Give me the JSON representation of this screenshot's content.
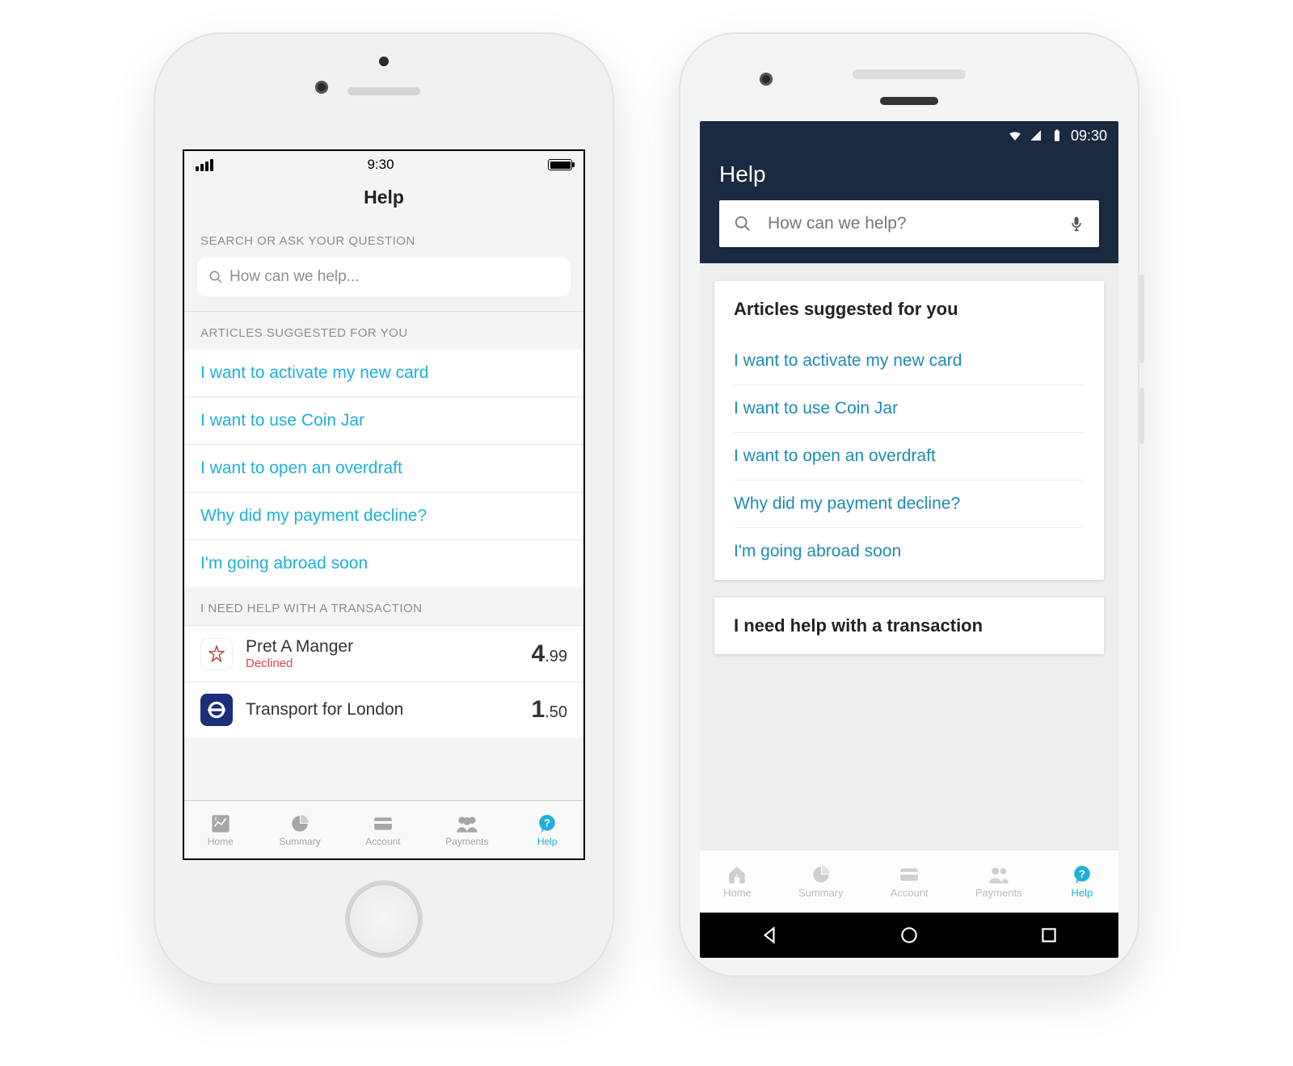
{
  "colors": {
    "accent": "#1eb0d8",
    "appbar": "#1a2a40",
    "declined": "#e3424d"
  },
  "tabs": [
    {
      "id": "home",
      "label": "Home"
    },
    {
      "id": "summary",
      "label": "Summary"
    },
    {
      "id": "account",
      "label": "Account"
    },
    {
      "id": "payments",
      "label": "Payments"
    },
    {
      "id": "help",
      "label": "Help",
      "active": true
    }
  ],
  "articles": [
    "I want to activate my new card",
    "I want to use Coin Jar",
    "I want to open an overdraft",
    "Why did my payment decline?",
    "I'm going abroad soon"
  ],
  "ios": {
    "status_time": "9:30",
    "page_title": "Help",
    "search_section_label": "SEARCH OR ASK YOUR QUESTION",
    "search_placeholder": "How can we help...",
    "articles_section_label": "ARTICLES SUGGESTED FOR YOU",
    "tx_section_label": "I NEED HELP WITH A TRANSACTION",
    "transactions": [
      {
        "merchant": "Pret A Manger",
        "status": "Declined",
        "amount_major": "4",
        "amount_minor": ".99",
        "icon": "pret-icon"
      },
      {
        "merchant": "Transport for London",
        "status": "",
        "amount_major": "1",
        "amount_minor": ".50",
        "icon": "tfl-icon"
      }
    ]
  },
  "android": {
    "status_time": "09:30",
    "page_title": "Help",
    "search_placeholder": "How can we help?",
    "articles_section_label": "Articles suggested for you",
    "tx_section_label": "I need help with a transaction"
  }
}
